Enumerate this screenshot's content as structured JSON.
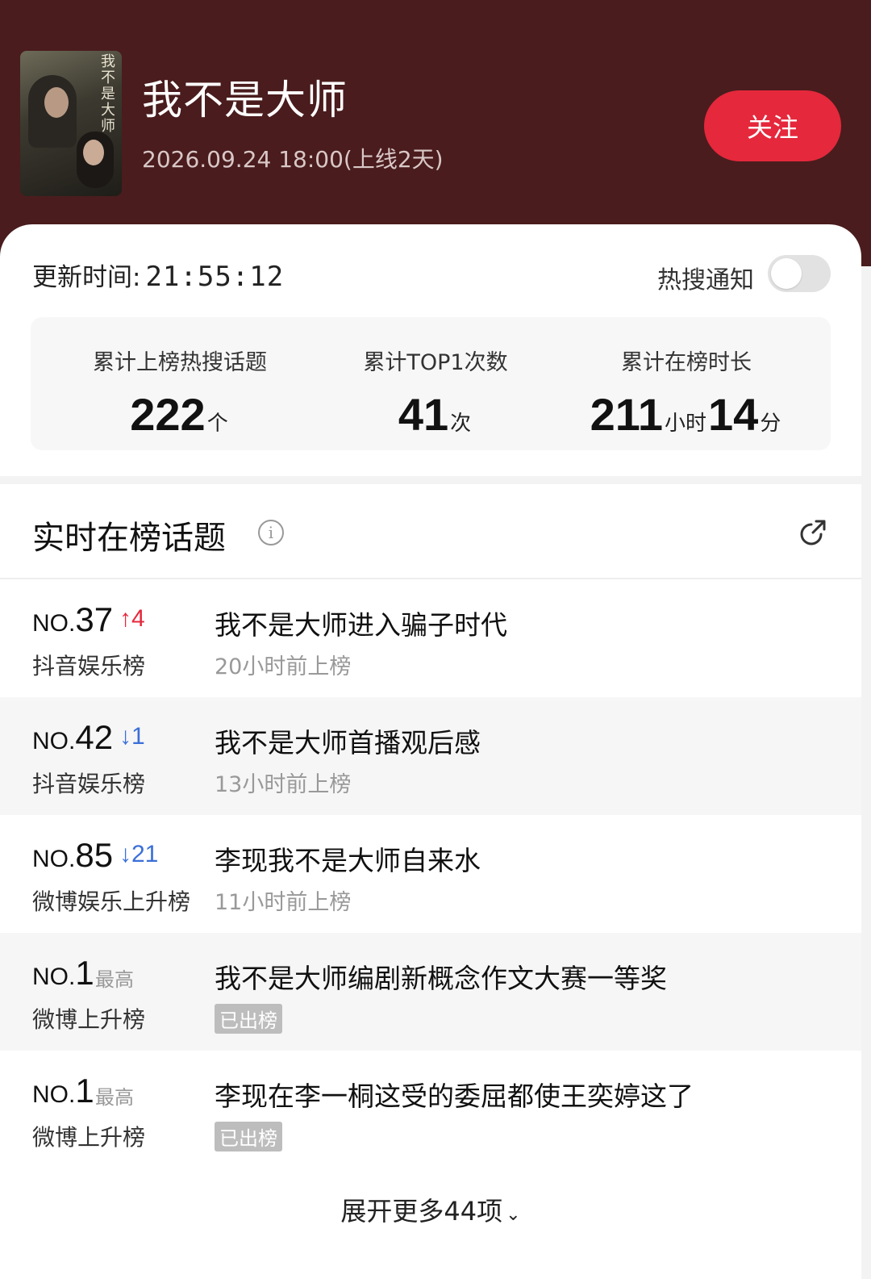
{
  "show": {
    "title": "我不是大师",
    "poster_title": "我不是大师",
    "meta": "2026.09.24 18:00(上线2天)",
    "follow_label": "关注"
  },
  "stats_card": {
    "update_label": "更新时间:",
    "update_time": "21:55:12",
    "notify_label": "热搜通知",
    "notify_on": false,
    "items": [
      {
        "label": "累计上榜热搜话题",
        "value": "222",
        "unit": "个"
      },
      {
        "label": "累计TOP1次数",
        "value": "41",
        "unit": "次"
      },
      {
        "label": "累计在榜时长",
        "value": "211",
        "unit": "小时",
        "value2": "14",
        "unit2": "分"
      }
    ]
  },
  "topics": {
    "title": "实时在榜话题",
    "rows": [
      {
        "no": "NO.",
        "rank": "37",
        "change": "↑4",
        "board": "抖音娱乐榜",
        "topic": "我不是大师进入骗子时代",
        "sub": "20小时前上榜"
      },
      {
        "no": "NO.",
        "rank": "42",
        "change": "↓1",
        "board": "抖音娱乐榜",
        "topic": "我不是大师首播观后感",
        "sub": "13小时前上榜"
      },
      {
        "no": "NO.",
        "rank": "85",
        "change": "↓21",
        "board": "微博娱乐上升榜",
        "topic": "李现我不是大师自来水",
        "sub": "11小时前上榜"
      },
      {
        "no": "NO.",
        "rank": "1",
        "best": "最高",
        "board": "微博上升榜",
        "topic": "我不是大师编剧新概念作文大赛一等奖",
        "tag": "已出榜"
      },
      {
        "no": "NO.",
        "rank": "1",
        "best": "最高",
        "board": "微博上升榜",
        "topic": "李现在李一桐这受的委屈都使王奕婷这了",
        "tag": "已出榜"
      }
    ],
    "expand_label": "展开更多44项"
  },
  "colors": {
    "header_bg": "#4a1c1d",
    "accent": "#e5283c",
    "up": "#e5283c",
    "down": "#3a6fd8"
  }
}
